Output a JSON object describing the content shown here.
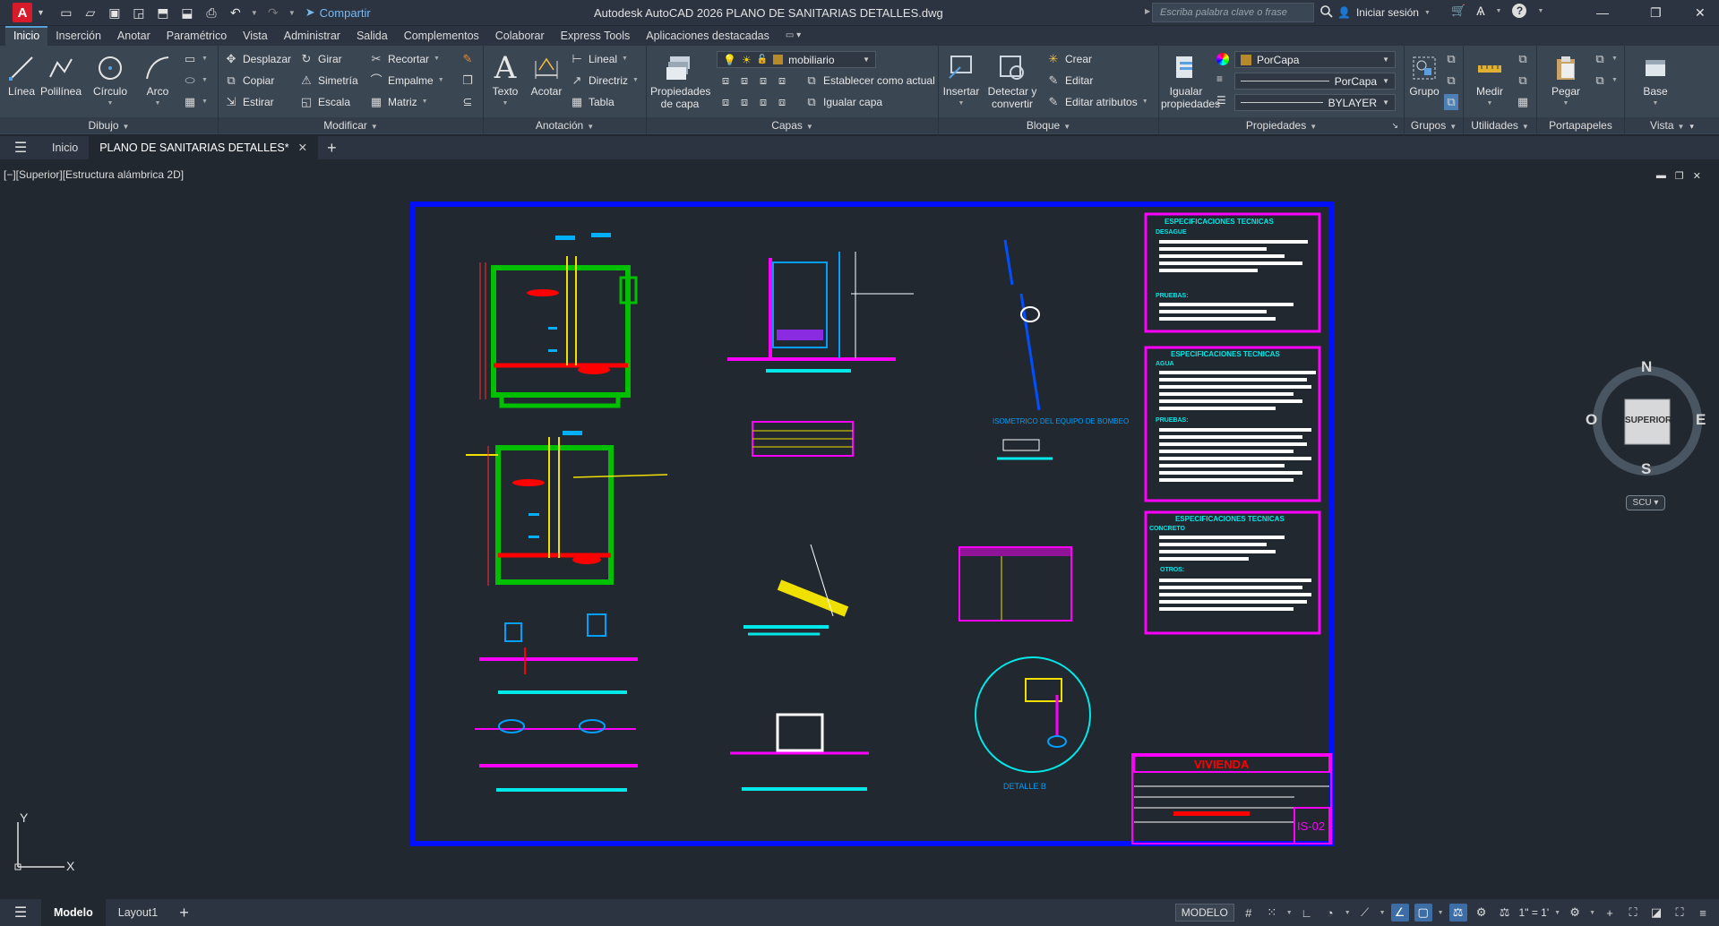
{
  "titlebar": {
    "app_logo": "A",
    "share_label": "Compartir",
    "window_title": "Autodesk AutoCAD 2026    PLANO DE SANITARIAS DETALLES.dwg",
    "search_placeholder": "Escriba palabra clave o frase",
    "signin_label": "Iniciar sesión"
  },
  "ribbon_tabs": [
    "Inicio",
    "Inserción",
    "Anotar",
    "Paramétrico",
    "Vista",
    "Administrar",
    "Salida",
    "Complementos",
    "Colaborar",
    "Express Tools",
    "Aplicaciones destacadas"
  ],
  "ribbon": {
    "dibujo": {
      "title": "Dibujo",
      "linea": "Línea",
      "polilinea": "Polilínea",
      "circulo": "Círculo",
      "arco": "Arco"
    },
    "modificar": {
      "title": "Modificar",
      "desplazar": "Desplazar",
      "girar": "Girar",
      "recortar": "Recortar",
      "copiar": "Copiar",
      "simetria": "Simetría",
      "empalme": "Empalme",
      "estirar": "Estirar",
      "escala": "Escala",
      "matriz": "Matriz"
    },
    "anotacion": {
      "title": "Anotación",
      "texto": "Texto",
      "acotar": "Acotar",
      "lineal": "Lineal",
      "directriz": "Directriz",
      "tabla": "Tabla"
    },
    "capas": {
      "title": "Capas",
      "propiedades": "Propiedades de capa",
      "layer_current": "mobiliario",
      "establecer": "Establecer como actual",
      "igualar": "Igualar capa"
    },
    "bloque": {
      "title": "Bloque",
      "insertar": "Insertar",
      "detectar": "Detectar y convertir",
      "crear": "Crear",
      "editar": "Editar",
      "editar_atributos": "Editar atributos"
    },
    "propiedades": {
      "title": "Propiedades",
      "igualar": "Igualar propiedades",
      "color": "PorCapa",
      "linetype": "PorCapa",
      "lineweight": "BYLAYER"
    },
    "grupos": {
      "title": "Grupos",
      "grupo": "Grupo"
    },
    "utilidades": {
      "title": "Utilidades",
      "medir": "Medir"
    },
    "portapapeles": {
      "title": "Portapapeles",
      "pegar": "Pegar"
    },
    "vista": {
      "title": "Vista",
      "base": "Base"
    }
  },
  "filetabs": {
    "home": "Inicio",
    "active": "PLANO DE SANITARIAS DETALLES*"
  },
  "viewport": {
    "label": "[−][Superior][Estructura alámbrica 2D]",
    "viewcube": {
      "top": "SUPERIOR",
      "n": "N",
      "s": "S",
      "e": "E",
      "w": "O",
      "wcs": "SCU"
    },
    "ucs_x": "X",
    "ucs_y": "Y"
  },
  "drawing": {
    "spec_title": "ESPECIFICACIONES TECNICAS",
    "spec1_sub": "DESAGUE",
    "spec1_sub2": "PRUEBAS:",
    "spec2_sub": "AGUA",
    "spec2_sub2": "PRUEBAS:",
    "spec3_sub": "CONCRETO",
    "spec3_sub2": "OTROS:",
    "isometric_label": "ISOMETRICO DEL EQUIPO DE BOMBEO",
    "detail_label": "DETALLE  B",
    "title_block": "VIVIENDA",
    "sheet_code": "IS-02"
  },
  "statusbar": {
    "tabs": [
      "Modelo",
      "Layout1"
    ],
    "model_label": "MODELO",
    "scale": "1\" = 1'"
  }
}
